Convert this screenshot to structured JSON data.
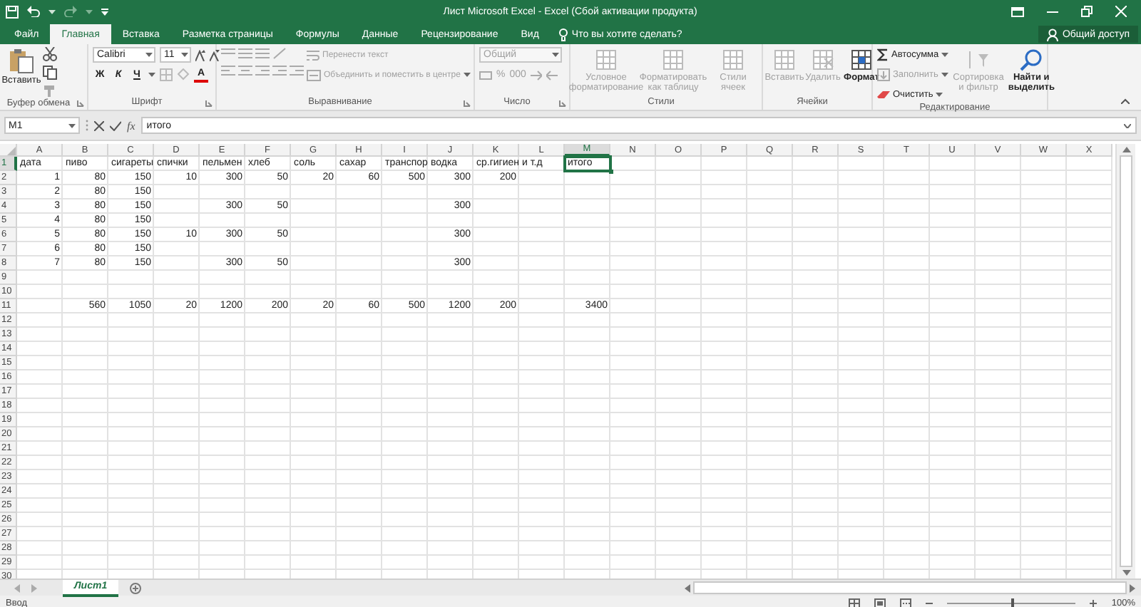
{
  "window": {
    "title": "Лист Microsoft Excel - Excel (Сбой активации продукта)"
  },
  "ribbon_tabs": [
    {
      "label": "Файл",
      "selected": false
    },
    {
      "label": "Главная",
      "selected": true
    },
    {
      "label": "Вставка",
      "selected": false
    },
    {
      "label": "Разметка страницы",
      "selected": false
    },
    {
      "label": "Формулы",
      "selected": false
    },
    {
      "label": "Данные",
      "selected": false
    },
    {
      "label": "Рецензирование",
      "selected": false
    },
    {
      "label": "Вид",
      "selected": false
    }
  ],
  "tell_me": "Что вы хотите сделать?",
  "share_button": "Общий доступ",
  "ribbon_groups": [
    {
      "kind": "clipboard",
      "label": "Буфер обмена",
      "controls": [
        {
          "label": "Вставить",
          "disabled": false
        }
      ]
    },
    {
      "kind": "font",
      "label": "Шрифт",
      "controls": [
        {
          "label": "Calibri",
          "disabled": false
        },
        {
          "label": "11",
          "disabled": false
        },
        {
          "label": "Ж",
          "disabled": false
        },
        {
          "label": "К",
          "disabled": false
        },
        {
          "label": "Ч",
          "disabled": false
        },
        {
          "label": "A",
          "disabled": false
        }
      ]
    },
    {
      "kind": "alignment",
      "label": "Выравнивание",
      "controls": [
        {
          "label": "Перенести текст",
          "disabled": true
        },
        {
          "label": "Объединить и поместить в центре",
          "disabled": true
        }
      ]
    },
    {
      "kind": "number",
      "label": "Число",
      "controls": [
        {
          "label": "Общий",
          "disabled": true
        },
        {
          "label": "%",
          "disabled": true
        },
        {
          "label": "000",
          "disabled": true
        }
      ]
    },
    {
      "kind": "styles",
      "label": "Стили",
      "controls": [
        {
          "label": "Условное форматирование",
          "disabled": true
        },
        {
          "label": "Форматировать как таблицу",
          "disabled": true
        },
        {
          "label": "Стили ячеек",
          "disabled": true
        }
      ]
    },
    {
      "kind": "cells",
      "label": "Ячейки",
      "controls": [
        {
          "label": "Вставить",
          "disabled": true
        },
        {
          "label": "Удалить",
          "disabled": true
        },
        {
          "label": "Формат",
          "disabled": false
        }
      ]
    },
    {
      "kind": "editing",
      "label": "Редактирование",
      "controls": [
        {
          "label": "Автосумма",
          "disabled": false
        },
        {
          "label": "Заполнить",
          "disabled": true
        },
        {
          "label": "Очистить",
          "disabled": false
        },
        {
          "label": "Сортировка и фильтр",
          "disabled": true
        },
        {
          "label": "Найти и выделить",
          "disabled": false
        }
      ]
    }
  ],
  "formula_bar": {
    "name_box": "M1",
    "function_label": "fx",
    "value": "итого"
  },
  "sheet": {
    "columns": [
      {
        "label": "A",
        "selected": false
      },
      {
        "label": "B",
        "selected": false
      },
      {
        "label": "C",
        "selected": false
      },
      {
        "label": "D",
        "selected": false
      },
      {
        "label": "E",
        "selected": false
      },
      {
        "label": "F",
        "selected": false
      },
      {
        "label": "G",
        "selected": false
      },
      {
        "label": "H",
        "selected": false
      },
      {
        "label": "I",
        "selected": false
      },
      {
        "label": "J",
        "selected": false
      },
      {
        "label": "K",
        "selected": false
      },
      {
        "label": "L",
        "selected": false
      },
      {
        "label": "M",
        "selected": true
      },
      {
        "label": "N",
        "selected": false
      },
      {
        "label": "O",
        "selected": false
      },
      {
        "label": "P",
        "selected": false
      },
      {
        "label": "Q",
        "selected": false
      },
      {
        "label": "R",
        "selected": false
      },
      {
        "label": "S",
        "selected": false
      },
      {
        "label": "T",
        "selected": false
      },
      {
        "label": "U",
        "selected": false
      },
      {
        "label": "V",
        "selected": false
      },
      {
        "label": "W",
        "selected": false
      },
      {
        "label": "X",
        "selected": false
      }
    ],
    "rows": [
      {
        "header": "1",
        "selected": true,
        "cells": [
          {
            "value": "дата",
            "kind": "text",
            "selected": false
          },
          {
            "value": "пиво",
            "kind": "text",
            "selected": false
          },
          {
            "value": "сигареты",
            "kind": "text",
            "selected": false
          },
          {
            "value": "спички",
            "kind": "text",
            "selected": false
          },
          {
            "value": "пельмен",
            "kind": "text",
            "selected": false
          },
          {
            "value": "хлеб",
            "kind": "text",
            "selected": false
          },
          {
            "value": "соль",
            "kind": "text",
            "selected": false
          },
          {
            "value": "сахар",
            "kind": "text",
            "selected": false
          },
          {
            "value": "транспор",
            "kind": "text",
            "selected": false
          },
          {
            "value": "водка",
            "kind": "text",
            "selected": false
          },
          {
            "value": "ср.гигиен",
            "kind": "text",
            "selected": false
          },
          {
            "value": "и т.д",
            "kind": "text",
            "selected": false
          },
          {
            "value": "итого",
            "kind": "text",
            "selected": true
          }
        ]
      },
      {
        "header": "2",
        "selected": false,
        "cells": [
          {
            "value": "1",
            "kind": "number",
            "selected": false
          },
          {
            "value": "80",
            "kind": "number",
            "selected": false
          },
          {
            "value": "150",
            "kind": "number",
            "selected": false
          },
          {
            "value": "10",
            "kind": "number",
            "selected": false
          },
          {
            "value": "300",
            "kind": "number",
            "selected": false
          },
          {
            "value": "50",
            "kind": "number",
            "selected": false
          },
          {
            "value": "20",
            "kind": "number",
            "selected": false
          },
          {
            "value": "60",
            "kind": "number",
            "selected": false
          },
          {
            "value": "500",
            "kind": "number",
            "selected": false
          },
          {
            "value": "300",
            "kind": "number",
            "selected": false
          },
          {
            "value": "200",
            "kind": "number",
            "selected": false
          }
        ]
      },
      {
        "header": "3",
        "selected": false,
        "cells": [
          {
            "value": "2",
            "kind": "number",
            "selected": false
          },
          {
            "value": "80",
            "kind": "number",
            "selected": false
          },
          {
            "value": "150",
            "kind": "number",
            "selected": false
          }
        ]
      },
      {
        "header": "4",
        "selected": false,
        "cells": [
          {
            "value": "3",
            "kind": "number",
            "selected": false
          },
          {
            "value": "80",
            "kind": "number",
            "selected": false
          },
          {
            "value": "150",
            "kind": "number",
            "selected": false
          },
          null,
          {
            "value": "300",
            "kind": "number",
            "selected": false
          },
          {
            "value": "50",
            "kind": "number",
            "selected": false
          },
          null,
          null,
          null,
          {
            "value": "300",
            "kind": "number",
            "selected": false
          }
        ]
      },
      {
        "header": "5",
        "selected": false,
        "cells": [
          {
            "value": "4",
            "kind": "number",
            "selected": false
          },
          {
            "value": "80",
            "kind": "number",
            "selected": false
          },
          {
            "value": "150",
            "kind": "number",
            "selected": false
          }
        ]
      },
      {
        "header": "6",
        "selected": false,
        "cells": [
          {
            "value": "5",
            "kind": "number",
            "selected": false
          },
          {
            "value": "80",
            "kind": "number",
            "selected": false
          },
          {
            "value": "150",
            "kind": "number",
            "selected": false
          },
          {
            "value": "10",
            "kind": "number",
            "selected": false
          },
          {
            "value": "300",
            "kind": "number",
            "selected": false
          },
          {
            "value": "50",
            "kind": "number",
            "selected": false
          },
          null,
          null,
          null,
          {
            "value": "300",
            "kind": "number",
            "selected": false
          }
        ]
      },
      {
        "header": "7",
        "selected": false,
        "cells": [
          {
            "value": "6",
            "kind": "number",
            "selected": false
          },
          {
            "value": "80",
            "kind": "number",
            "selected": false
          },
          {
            "value": "150",
            "kind": "number",
            "selected": false
          }
        ]
      },
      {
        "header": "8",
        "selected": false,
        "cells": [
          {
            "value": "7",
            "kind": "number",
            "selected": false
          },
          {
            "value": "80",
            "kind": "number",
            "selected": false
          },
          {
            "value": "150",
            "kind": "number",
            "selected": false
          },
          null,
          {
            "value": "300",
            "kind": "number",
            "selected": false
          },
          {
            "value": "50",
            "kind": "number",
            "selected": false
          },
          null,
          null,
          null,
          {
            "value": "300",
            "kind": "number",
            "selected": false
          }
        ]
      },
      {
        "header": "9",
        "selected": false
      },
      {
        "header": "10",
        "selected": false
      },
      {
        "header": "11",
        "selected": false,
        "cells": [
          null,
          {
            "value": "560",
            "kind": "number",
            "selected": false
          },
          {
            "value": "1050",
            "kind": "number",
            "selected": false
          },
          {
            "value": "20",
            "kind": "number",
            "selected": false
          },
          {
            "value": "1200",
            "kind": "number",
            "selected": false
          },
          {
            "value": "200",
            "kind": "number",
            "selected": false
          },
          {
            "value": "20",
            "kind": "number",
            "selected": false
          },
          {
            "value": "60",
            "kind": "number",
            "selected": false
          },
          {
            "value": "500",
            "kind": "number",
            "selected": false
          },
          {
            "value": "1200",
            "kind": "number",
            "selected": false
          },
          {
            "value": "200",
            "kind": "number",
            "selected": false
          },
          null,
          {
            "value": "3400",
            "kind": "number",
            "selected": false
          }
        ]
      },
      {
        "header": "12",
        "selected": false
      },
      {
        "header": "13",
        "selected": false
      },
      {
        "header": "14",
        "selected": false
      },
      {
        "header": "15",
        "selected": false
      },
      {
        "header": "16",
        "selected": false
      },
      {
        "header": "17",
        "selected": false
      },
      {
        "header": "18",
        "selected": false
      },
      {
        "header": "19",
        "selected": false
      },
      {
        "header": "20",
        "selected": false
      },
      {
        "header": "21",
        "selected": false
      },
      {
        "header": "22",
        "selected": false
      },
      {
        "header": "23",
        "selected": false
      },
      {
        "header": "24",
        "selected": false
      },
      {
        "header": "25",
        "selected": false
      },
      {
        "header": "26",
        "selected": false
      },
      {
        "header": "27",
        "selected": false
      },
      {
        "header": "28",
        "selected": false
      },
      {
        "header": "29",
        "selected": false
      },
      {
        "header": "30",
        "selected": false
      }
    ]
  },
  "sheet_tabs": [
    {
      "label": "Лист1",
      "selected": true
    }
  ],
  "status_bar": {
    "mode": "Ввод",
    "zoom": {
      "level": 0.5,
      "reading": "100%"
    }
  }
}
